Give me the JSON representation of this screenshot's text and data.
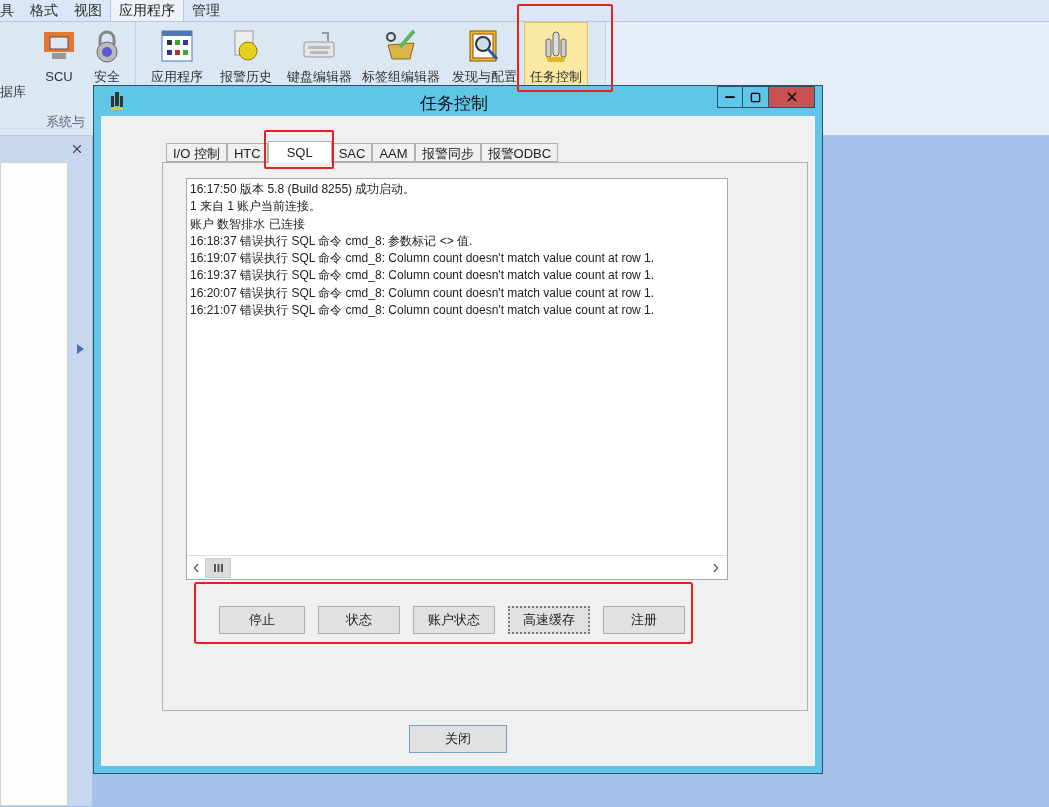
{
  "ribbon": {
    "tabs": [
      {
        "label": "具",
        "selected": false
      },
      {
        "label": "格式",
        "selected": false
      },
      {
        "label": "视图",
        "selected": false
      },
      {
        "label": "应用程序",
        "selected": true
      },
      {
        "label": "管理",
        "selected": false
      }
    ],
    "left_fragment": "据库",
    "groups": [
      {
        "label": "系统与",
        "buttons": [
          {
            "label": "SCU",
            "selected": false
          },
          {
            "label": "安全",
            "selected": false
          }
        ]
      },
      {
        "buttons": [
          {
            "label": "应用程序",
            "selected": false
          },
          {
            "label": "报警历史",
            "selected": false
          },
          {
            "label": "键盘编辑器",
            "selected": false
          },
          {
            "label": "标签组编辑器",
            "selected": false
          },
          {
            "label": "发现与配置",
            "selected": false
          },
          {
            "label": "任务控制",
            "selected": true
          }
        ]
      }
    ]
  },
  "dialog": {
    "title": "任务控制",
    "tabs": [
      {
        "label": "I/O 控制",
        "selected": false
      },
      {
        "label": "HTC",
        "selected": false
      },
      {
        "label": "SQL",
        "selected": true
      },
      {
        "label": "SAC",
        "selected": false
      },
      {
        "label": "AAM",
        "selected": false
      },
      {
        "label": "报警同步",
        "selected": false
      },
      {
        "label": "报警ODBC",
        "selected": false
      }
    ],
    "log": [
      "16:17:50 版本 5.8 (Build 8255) 成功启动。",
      "1 来自 1 账户当前连接。",
      "账户 数智排水 已连接",
      "16:18:37 错误执行 SQL 命令 cmd_8: 参数标记 <> 值.",
      "16:19:07 错误执行 SQL 命令 cmd_8: Column count doesn't match value count at row 1.",
      "16:19:37 错误执行 SQL 命令 cmd_8: Column count doesn't match value count at row 1.",
      "16:20:07 错误执行 SQL 命令 cmd_8: Column count doesn't match value count at row 1.",
      "16:21:07 错误执行 SQL 命令 cmd_8: Column count doesn't match value count at row 1."
    ],
    "buttons": [
      {
        "label": "停止",
        "focused": false
      },
      {
        "label": "状态",
        "focused": false
      },
      {
        "label": "账户状态",
        "focused": false
      },
      {
        "label": "高速缓存",
        "focused": true
      },
      {
        "label": "注册",
        "focused": false
      }
    ],
    "close_button": "关闭"
  }
}
